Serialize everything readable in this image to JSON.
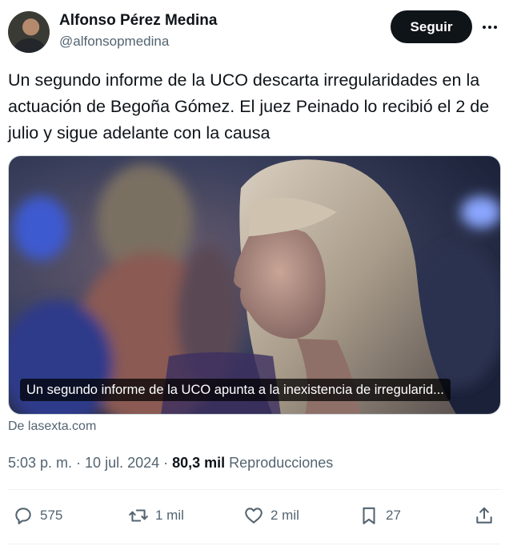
{
  "author": {
    "name": "Alfonso Pérez Medina",
    "handle": "@alfonsopmedina"
  },
  "follow_label": "Seguir",
  "tweet_text": "Un segundo informe de la UCO descarta irregularidades en la actuación de Begoña Gómez. El juez Peinado lo recibió el 2 de julio y sigue adelante con la causa",
  "card": {
    "caption": "Un segundo informe de la UCO apunta a la inexistencia de irregularid...",
    "source": "De lasexta.com"
  },
  "meta": {
    "time": "5:03 p. m.",
    "sep1": " · ",
    "date": "10 jul. 2024",
    "sep2": " · ",
    "views_count": "80,3 mil",
    "views_label": " Reproducciones"
  },
  "actions": {
    "replies": "575",
    "reposts": "1 mil",
    "likes": "2 mil",
    "bookmarks": "27"
  },
  "icons": {
    "more": "more-horizontal-icon",
    "reply": "reply-icon",
    "repost": "repost-icon",
    "like": "heart-icon",
    "bookmark": "bookmark-icon",
    "share": "share-icon"
  }
}
